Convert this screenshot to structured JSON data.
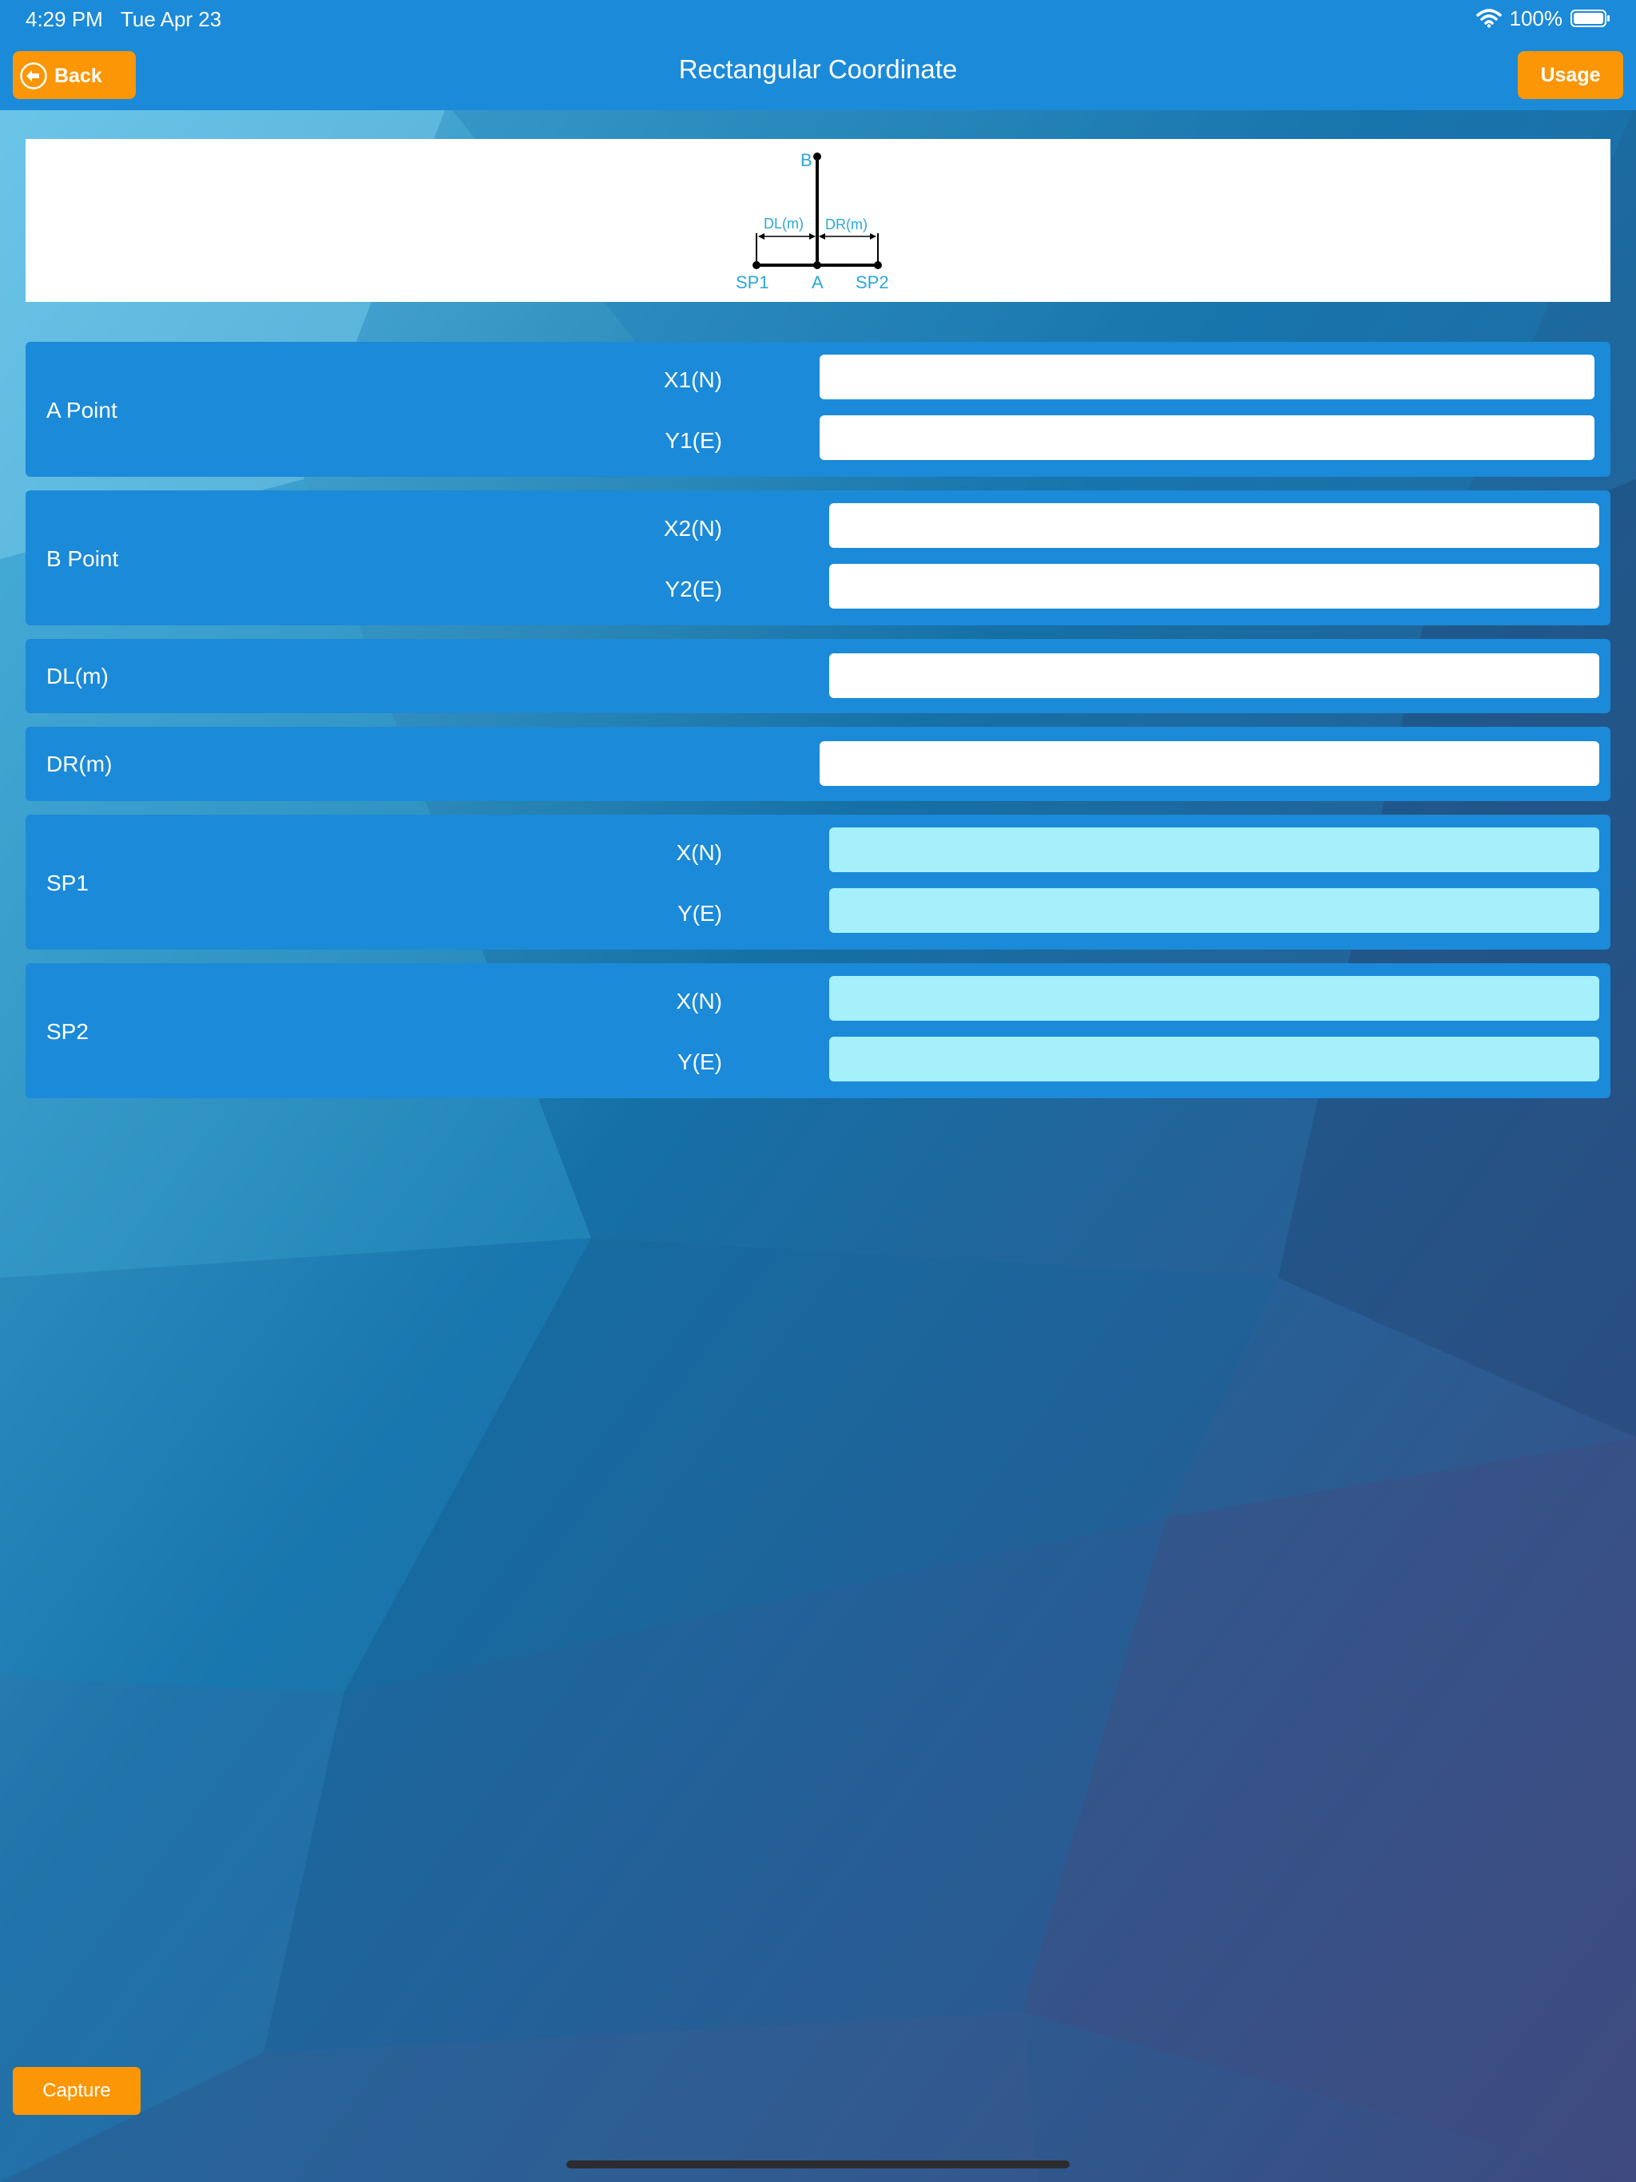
{
  "status_bar": {
    "time": "4:29 PM",
    "date": "Tue Apr 23",
    "battery": "100%",
    "wifi_icon": "wifi-icon",
    "battery_icon": "battery-icon"
  },
  "nav": {
    "back_label": "Back",
    "back_icon": "arrow-left-circle-icon",
    "title": "Rectangular Coordinate",
    "usage_label": "Usage"
  },
  "diagram": {
    "labels": {
      "b": "B",
      "a": "A",
      "sp1": "SP1",
      "sp2": "SP2",
      "dl": "DL(m)",
      "dr": "DR(m)"
    }
  },
  "panels": {
    "a_point": {
      "title": "A Point",
      "x_label": "X1(N)",
      "y_label": "Y1(E)",
      "x_value": "",
      "y_value": ""
    },
    "b_point": {
      "title": "B Point",
      "x_label": "X2(N)",
      "y_label": "Y2(E)",
      "x_value": "",
      "y_value": ""
    },
    "dl": {
      "title": "DL(m)",
      "value": ""
    },
    "dr": {
      "title": "DR(m)",
      "value": ""
    },
    "sp1": {
      "title": "SP1",
      "x_label": "X(N)",
      "y_label": "Y(E)",
      "x_value": "",
      "y_value": ""
    },
    "sp2": {
      "title": "SP2",
      "x_label": "X(N)",
      "y_label": "Y(E)",
      "x_value": "",
      "y_value": ""
    }
  },
  "footer": {
    "capture_label": "Capture"
  },
  "colors": {
    "bar": "#1b8ad8",
    "accent": "#fb9606",
    "panel": "#1b8ad8",
    "input": "#ffffff",
    "result_input": "#a6f0fb",
    "diagram_text": "#2aa8d8"
  }
}
